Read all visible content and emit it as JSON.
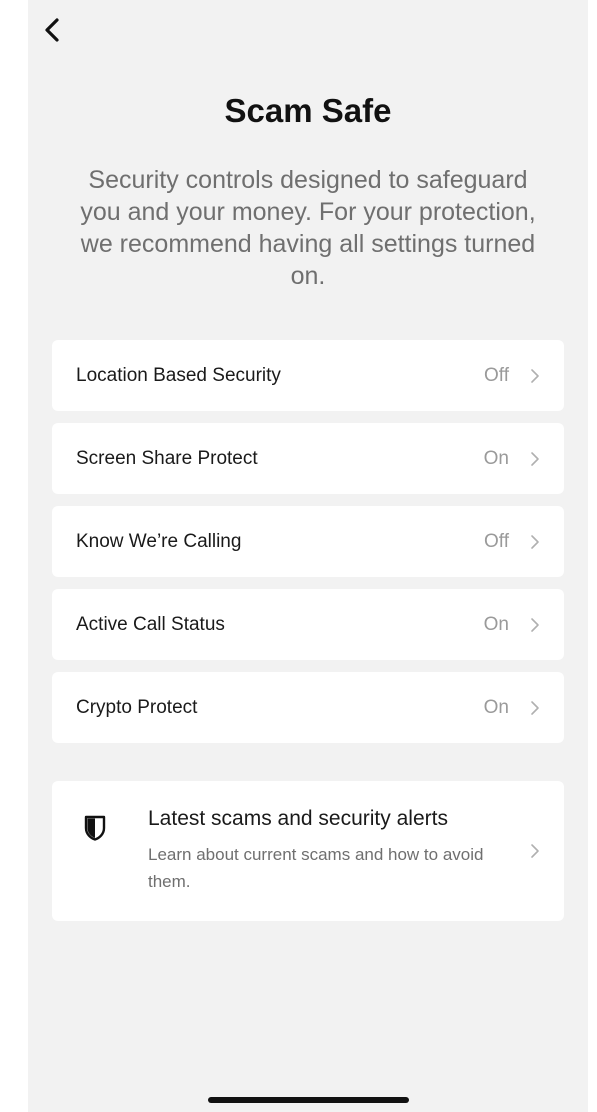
{
  "header": {
    "back_icon": "chevron-left-icon"
  },
  "title": "Scam Safe",
  "subtitle": "Security controls designed to safeguard you and your money. For your protection, we recommend having all settings turned on.",
  "settings": [
    {
      "label": "Location Based Security",
      "status": "Off"
    },
    {
      "label": "Screen Share Protect",
      "status": "On"
    },
    {
      "label": "Know We’re Calling",
      "status": "Off"
    },
    {
      "label": "Active Call Status",
      "status": "On"
    },
    {
      "label": "Crypto Protect",
      "status": "On"
    }
  ],
  "alerts": {
    "icon": "shield-icon",
    "title": "Latest scams and security alerts",
    "description": "Learn about current scams and how to avoid them."
  },
  "colors": {
    "background": "#f2f2f2",
    "card": "#ffffff",
    "text_primary": "#1a1a1a",
    "text_secondary": "#6f6f6f",
    "status_text": "#9a9a9a"
  }
}
